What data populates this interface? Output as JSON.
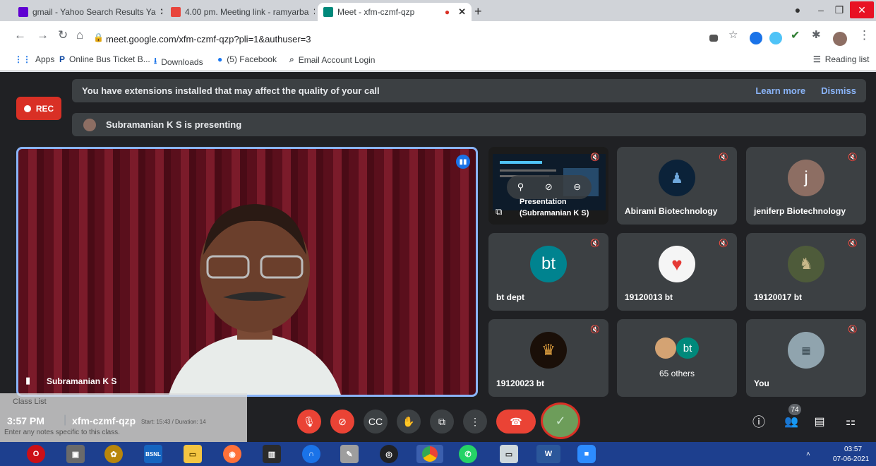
{
  "browser": {
    "tabs": [
      {
        "title": "gmail - Yahoo Search Results Ya",
        "color": "#6001d2"
      },
      {
        "title": "4.00 pm. Meeting link - ramyarba",
        "color": "#e8453c"
      },
      {
        "title": "Meet - xfm-czmf-qzp",
        "color": "#00897b"
      }
    ],
    "url": "meet.google.com/xfm-czmf-qzp?pli=1&authuser=3",
    "bookmarks": [
      "Apps",
      "Online Bus Ticket B...",
      "Downloads",
      "(5) Facebook",
      "Email Account Login"
    ],
    "reading_list": "Reading list"
  },
  "meet": {
    "rec_label": "REC",
    "banner_warning": "You have extensions installed that may affect the quality of your call",
    "learn_more": "Learn more",
    "dismiss": "Dismiss",
    "presenting_text": "Subramanian K S is presenting",
    "main_speaker": "Subramanian K S",
    "presentation_tile": {
      "line1": "Presentation",
      "line2": "(Subramanian K S)"
    },
    "tiles": [
      {
        "name": "Abirami Biotechnology"
      },
      {
        "name": "jeniferp Biotechnology",
        "initial": "j",
        "color": "#8d6e63"
      },
      {
        "name": "bt dept",
        "initial": "bt",
        "color": "#00838f"
      },
      {
        "name": "19120013 bt"
      },
      {
        "name": "19120017 bt"
      },
      {
        "name": "19120023 bt"
      },
      {
        "name": "65 others",
        "initial": "bt",
        "color": "#00897b"
      },
      {
        "name": "You"
      }
    ],
    "time": "3:57 PM",
    "meeting_code": "xfm-czmf-qzp",
    "participant_count": "74"
  },
  "overlay": {
    "class_list": "Class List",
    "notes_placeholder": "Enter any notes specific to this class.",
    "start_text": "Start: 15:43 / Duration: 14"
  },
  "taskbar": {
    "clock_time": "03:57",
    "clock_date": "07-06-2021"
  }
}
